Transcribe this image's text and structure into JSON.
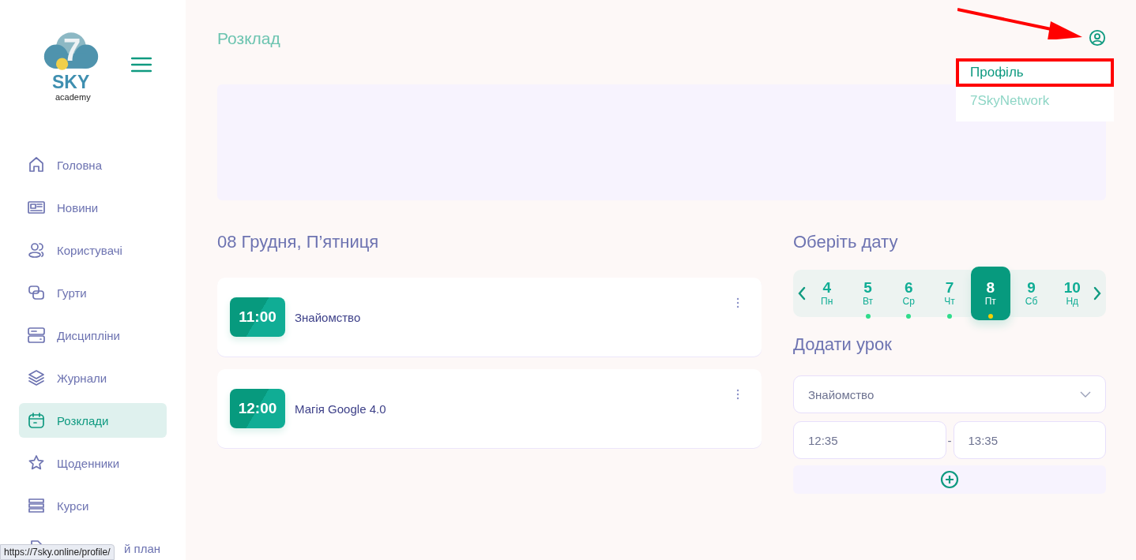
{
  "logo": {
    "number": "7",
    "name": "SKY",
    "sub": "academy"
  },
  "sidebar": {
    "items": [
      {
        "kind": "home",
        "label": "Головна",
        "selected": false
      },
      {
        "kind": "news",
        "label": "Новини",
        "selected": false
      },
      {
        "kind": "users",
        "label": "Користувачі",
        "selected": false
      },
      {
        "kind": "groups",
        "label": "Гурти",
        "selected": false
      },
      {
        "kind": "disciplines",
        "label": "Дисципліни",
        "selected": false
      },
      {
        "kind": "journals",
        "label": "Журнали",
        "selected": false
      },
      {
        "kind": "calendar",
        "label": "Розклади",
        "selected": true
      },
      {
        "kind": "diaries",
        "label": "Щоденники",
        "selected": false
      },
      {
        "kind": "courses",
        "label": "Курси",
        "selected": false
      },
      {
        "kind": "plan",
        "label": "й план",
        "selected": false
      }
    ]
  },
  "status_url": "https://7sky.online/profile/",
  "page_title": "Розклад",
  "user_menu": {
    "items": [
      {
        "label": "Профіль",
        "selected": true
      },
      {
        "label": "7SkyNetwork",
        "selected": false
      }
    ]
  },
  "day_title": "08 Грудня, П’ятниця",
  "lessons": [
    {
      "time": "11:00",
      "name": "Знайомство"
    },
    {
      "time": "12:00",
      "name": "Магія Google 4.0"
    }
  ],
  "date_picker": {
    "title": "Оберіть дату",
    "days": [
      {
        "day": "4",
        "weekday": "Пн",
        "selected": false
      },
      {
        "day": "5",
        "weekday": "Вт",
        "selected": false,
        "color": "#2fdc8c"
      },
      {
        "day": "6",
        "weekday": "Ср",
        "selected": false,
        "color": "#2fdc8c"
      },
      {
        "day": "7",
        "weekday": "Чт",
        "selected": false,
        "color": "#2fdc8c"
      },
      {
        "day": "8",
        "weekday": "Пт",
        "selected": true,
        "color": "#f5d000"
      },
      {
        "day": "9",
        "weekday": "Сб",
        "selected": false
      },
      {
        "day": "10",
        "weekday": "Нд",
        "selected": false
      }
    ]
  },
  "add_lesson": {
    "title": "Додати урок",
    "lesson": "Знайомство",
    "start": "12:35",
    "separator": "-",
    "end": "13:35"
  }
}
